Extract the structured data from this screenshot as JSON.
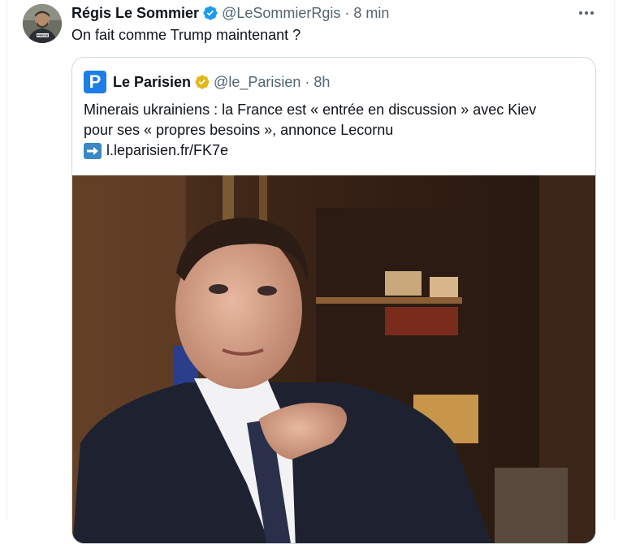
{
  "tweet": {
    "author_name": "Régis Le Sommier",
    "author_handle": "@LeSommierRgis",
    "separator": "·",
    "time": "8 min",
    "text": "On fait comme Trump maintenant ?",
    "avatar_badge": "PRESS"
  },
  "quoted": {
    "logo_letter": "P",
    "author_name": "Le Parisien",
    "author_handle": "@le_Parisien",
    "separator": "·",
    "time": "8h",
    "text_line1": "Minerais ukrainiens : la France est « entrée en discussion » avec Kiev",
    "text_line2": "pour ses « propres besoins », annonce Lecornu",
    "link": "l.leparisien.fr/FK7e"
  },
  "colors": {
    "verified_blue": "#1d9bf0",
    "verified_gold": "#e2b719",
    "secondary_text": "#536471",
    "logo_blue": "#1d7ee6"
  },
  "icons": [
    "verified-badge-icon",
    "more-options-icon",
    "arrow-right-emoji-icon"
  ]
}
